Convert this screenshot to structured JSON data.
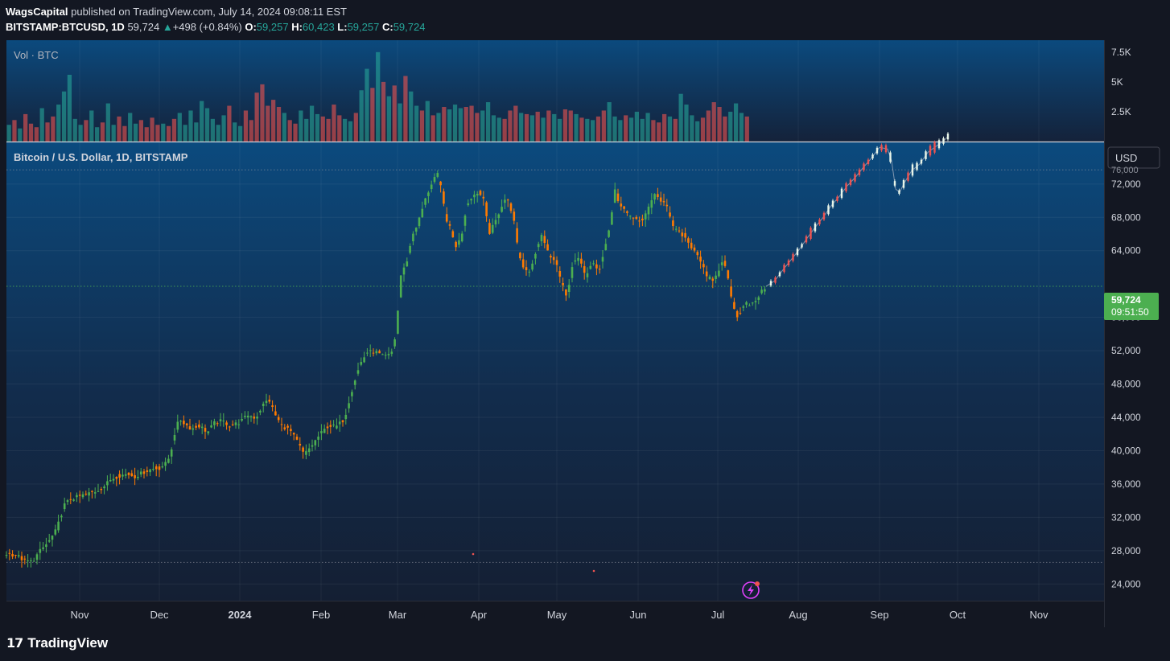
{
  "header": {
    "author": "WagsCapital",
    "published_text": " published on TradingView.com, July 14, 2024 09:08:11 EST",
    "symbol": "BITSTAMP:BTCUSD, 1D",
    "last": "59,724",
    "change_arrow": "▲",
    "change": "+498 (+0.84%)",
    "o_label": "O:",
    "o_value": "59,257",
    "h_label": "H:",
    "h_value": "60,423",
    "l_label": "L:",
    "l_value": "59,257",
    "c_label": "C:",
    "c_value": "59,724"
  },
  "volume_pane": {
    "label": "Vol · BTC",
    "ticks": [
      "7.5K",
      "5K",
      "2.5K"
    ]
  },
  "price_pane": {
    "title": "Bitcoin / U.S. Dollar, 1D, BITSTAMP",
    "currency_button": "USD",
    "last_price_label": "59,724",
    "countdown_label": "09:51:50",
    "partial_top_tick": "76,000"
  },
  "footer": {
    "logo_text": "TradingView"
  },
  "colors": {
    "up": "#26a69a",
    "down": "#ef5350",
    "candle_up": "#4caf50",
    "candle_down": "#ff7b00",
    "last_price_bg": "#4caf50"
  },
  "chart_data": {
    "type": "candlestick",
    "title": "Bitcoin / U.S. Dollar, 1D, BITSTAMP",
    "xlabel": "",
    "ylabel": "",
    "x_ticks": [
      "Nov",
      "Dec",
      "2024",
      "Feb",
      "Mar",
      "Apr",
      "May",
      "Jun",
      "Jul",
      "Aug",
      "Sep",
      "Oct",
      "Nov"
    ],
    "y_ticks": [
      24000,
      28000,
      32000,
      36000,
      40000,
      44000,
      48000,
      52000,
      56000,
      64000,
      68000,
      72000
    ],
    "ylim": [
      22000,
      77000
    ],
    "last_price": 59724,
    "horizontal_levels": [
      73700,
      59724,
      26600
    ],
    "price_path": [
      [
        0,
        27600
      ],
      [
        12,
        27500
      ],
      [
        22,
        26800
      ],
      [
        32,
        26700
      ],
      [
        42,
        28000
      ],
      [
        52,
        29000
      ],
      [
        62,
        30500
      ],
      [
        72,
        33500
      ],
      [
        80,
        34200
      ],
      [
        90,
        34500
      ],
      [
        100,
        34800
      ],
      [
        110,
        35100
      ],
      [
        120,
        35600
      ],
      [
        130,
        36600
      ],
      [
        140,
        37000
      ],
      [
        150,
        37200
      ],
      [
        160,
        36900
      ],
      [
        170,
        37400
      ],
      [
        180,
        37800
      ],
      [
        190,
        37900
      ],
      [
        200,
        38600
      ],
      [
        205,
        40200
      ],
      [
        210,
        42500
      ],
      [
        215,
        43800
      ],
      [
        222,
        43200
      ],
      [
        230,
        42600
      ],
      [
        240,
        43000
      ],
      [
        250,
        42200
      ],
      [
        258,
        43300
      ],
      [
        268,
        43600
      ],
      [
        278,
        43000
      ],
      [
        290,
        43400
      ],
      [
        300,
        44300
      ],
      [
        310,
        43900
      ],
      [
        318,
        45400
      ],
      [
        326,
        46200
      ],
      [
        334,
        44300
      ],
      [
        342,
        43000
      ],
      [
        352,
        42500
      ],
      [
        362,
        41000
      ],
      [
        370,
        39500
      ],
      [
        380,
        40700
      ],
      [
        390,
        42000
      ],
      [
        400,
        43000
      ],
      [
        410,
        42900
      ],
      [
        420,
        43800
      ],
      [
        425,
        45700
      ],
      [
        432,
        48200
      ],
      [
        440,
        50500
      ],
      [
        448,
        51800
      ],
      [
        458,
        51900
      ],
      [
        468,
        51300
      ],
      [
        478,
        51500
      ],
      [
        484,
        54000
      ],
      [
        490,
        61000
      ],
      [
        497,
        62500
      ],
      [
        505,
        66000
      ],
      [
        512,
        67500
      ],
      [
        520,
        70000
      ],
      [
        528,
        72000
      ],
      [
        535,
        73400
      ],
      [
        540,
        71500
      ],
      [
        546,
        68000
      ],
      [
        552,
        66500
      ],
      [
        558,
        64500
      ],
      [
        565,
        65500
      ],
      [
        572,
        69500
      ],
      [
        578,
        70500
      ],
      [
        586,
        71000
      ],
      [
        594,
        70200
      ],
      [
        600,
        66000
      ],
      [
        606,
        67200
      ],
      [
        614,
        69000
      ],
      [
        622,
        70500
      ],
      [
        630,
        68000
      ],
      [
        636,
        64000
      ],
      [
        642,
        62000
      ],
      [
        650,
        61500
      ],
      [
        658,
        64000
      ],
      [
        665,
        66000
      ],
      [
        674,
        63500
      ],
      [
        682,
        63000
      ],
      [
        690,
        60000
      ],
      [
        696,
        58500
      ],
      [
        704,
        62500
      ],
      [
        712,
        63000
      ],
      [
        720,
        61000
      ],
      [
        728,
        62500
      ],
      [
        736,
        61500
      ],
      [
        744,
        64500
      ],
      [
        750,
        67000
      ],
      [
        756,
        71300
      ],
      [
        762,
        69500
      ],
      [
        770,
        68500
      ],
      [
        778,
        68000
      ],
      [
        786,
        67400
      ],
      [
        794,
        68200
      ],
      [
        800,
        69500
      ],
      [
        806,
        71100
      ],
      [
        812,
        70200
      ],
      [
        820,
        69400
      ],
      [
        826,
        67400
      ],
      [
        834,
        66200
      ],
      [
        842,
        65800
      ],
      [
        850,
        64600
      ],
      [
        856,
        64000
      ],
      [
        862,
        63000
      ],
      [
        870,
        60800
      ],
      [
        878,
        60500
      ],
      [
        884,
        61200
      ],
      [
        890,
        63000
      ],
      [
        896,
        61000
      ],
      [
        902,
        58000
      ],
      [
        908,
        56000
      ],
      [
        914,
        57000
      ],
      [
        920,
        57700
      ],
      [
        926,
        57400
      ],
      [
        932,
        58200
      ],
      [
        938,
        59000
      ],
      [
        944,
        59724
      ]
    ],
    "projection_path": [
      [
        944,
        59724
      ],
      [
        955,
        60400
      ],
      [
        965,
        61700
      ],
      [
        975,
        62900
      ],
      [
        985,
        64100
      ],
      [
        995,
        65500
      ],
      [
        1005,
        66800
      ],
      [
        1015,
        68000
      ],
      [
        1025,
        69400
      ],
      [
        1035,
        70500
      ],
      [
        1045,
        71800
      ],
      [
        1055,
        72800
      ],
      [
        1065,
        74000
      ],
      [
        1075,
        75100
      ],
      [
        1085,
        76400
      ],
      [
        1095,
        76200
      ],
      [
        1100,
        74800
      ],
      [
        1105,
        71400
      ],
      [
        1110,
        71000
      ],
      [
        1115,
        72000
      ],
      [
        1125,
        73600
      ],
      [
        1135,
        74400
      ],
      [
        1145,
        75800
      ],
      [
        1155,
        76500
      ],
      [
        1165,
        77200
      ],
      [
        1170,
        77700
      ]
    ],
    "volume": {
      "ylim": [
        0,
        8500
      ],
      "count": 135,
      "series": [
        1400,
        1800,
        1100,
        2300,
        1500,
        1200,
        2800,
        1600,
        2100,
        3100,
        4200,
        5600,
        1900,
        1400,
        1800,
        2600,
        1200,
        1600,
        3200,
        1400,
        2100,
        1300,
        2400,
        1500,
        1800,
        1200,
        2000,
        1400,
        1500,
        1300,
        1900,
        2400,
        1400,
        2600,
        1600,
        3400,
        2800,
        1900,
        1400,
        2200,
        3000,
        1600,
        1300,
        2600,
        1800,
        4100,
        4800,
        3000,
        3500,
        2900,
        2400,
        1800,
        1500,
        2600,
        1900,
        3000,
        2300,
        2100,
        1900,
        3100,
        2200,
        1900,
        1700,
        2400,
        4300,
        6100,
        4500,
        7500,
        5000,
        3800,
        4700,
        3200,
        5500,
        4200,
        3000,
        2600,
        3400,
        2200,
        2400,
        2900,
        2700,
        3100,
        2800,
        2900,
        3000,
        2400,
        2600,
        3300,
        2200,
        2000,
        1900,
        2600,
        3000,
        2400,
        2300,
        2200,
        2500,
        2000,
        2600,
        2300,
        1900,
        2700,
        2600,
        2300,
        2000,
        1900,
        1800,
        2100,
        2600,
        3300,
        2100,
        1800,
        2200,
        2000,
        2500,
        1900,
        2400,
        1800,
        1600,
        2300,
        2100,
        1900,
        4000,
        3100,
        2200,
        1700,
        2000,
        2600,
        3300,
        2900,
        2100,
        2500,
        3200,
        2400,
        2100
      ]
    }
  }
}
